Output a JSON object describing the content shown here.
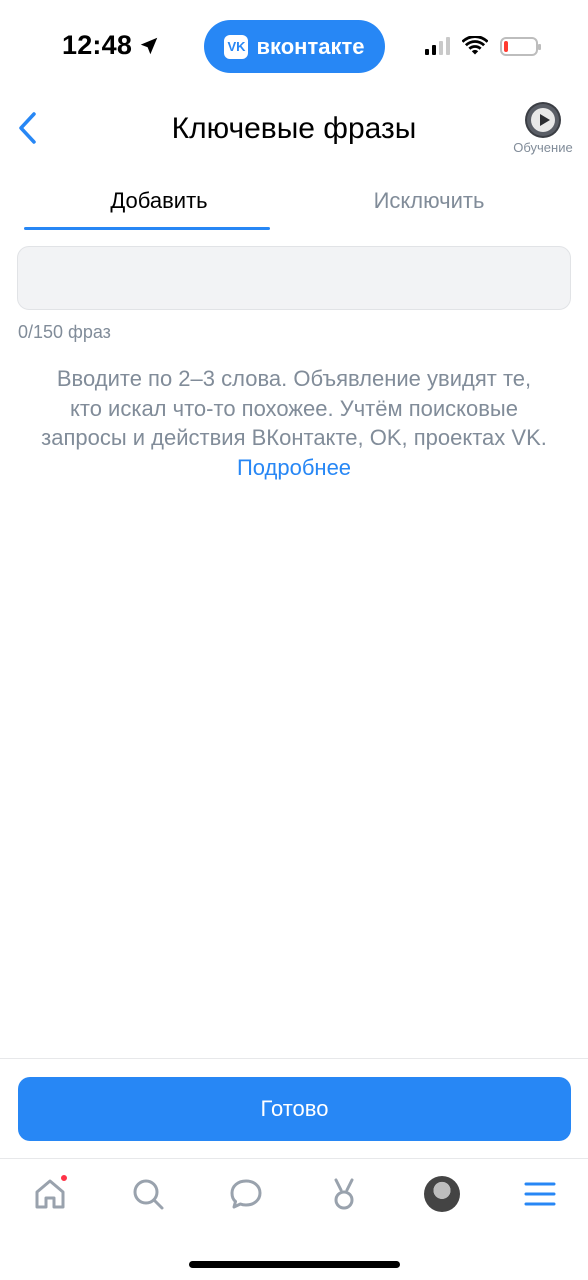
{
  "status_bar": {
    "time": "12:48",
    "app_pill": "вконтакте",
    "app_logo": "VK"
  },
  "header": {
    "title": "Ключевые фразы",
    "tutorial_label": "Обучение"
  },
  "tabs": [
    {
      "label": "Добавить",
      "active": true
    },
    {
      "label": "Исключить",
      "active": false
    }
  ],
  "phrases_input": {
    "value": "",
    "counter": "0/150 фраз"
  },
  "hint": {
    "text": "Вводите по 2–3 слова. Объявление увидят те, кто искал что-то похожее. Учтём поисковые запросы и действия ВКонтакте, OK, проектах VK.",
    "link": "Подробнее"
  },
  "footer": {
    "done_label": "Готово"
  },
  "tabbar": {
    "items": [
      "home-icon",
      "search-icon",
      "messages-icon",
      "clips-icon",
      "avatar",
      "menu-icon"
    ],
    "home_has_badge": true
  },
  "colors": {
    "accent": "#2787F5",
    "secondary_text": "#818c99",
    "input_bg": "#f2f3f5",
    "badge": "#ff3347"
  }
}
